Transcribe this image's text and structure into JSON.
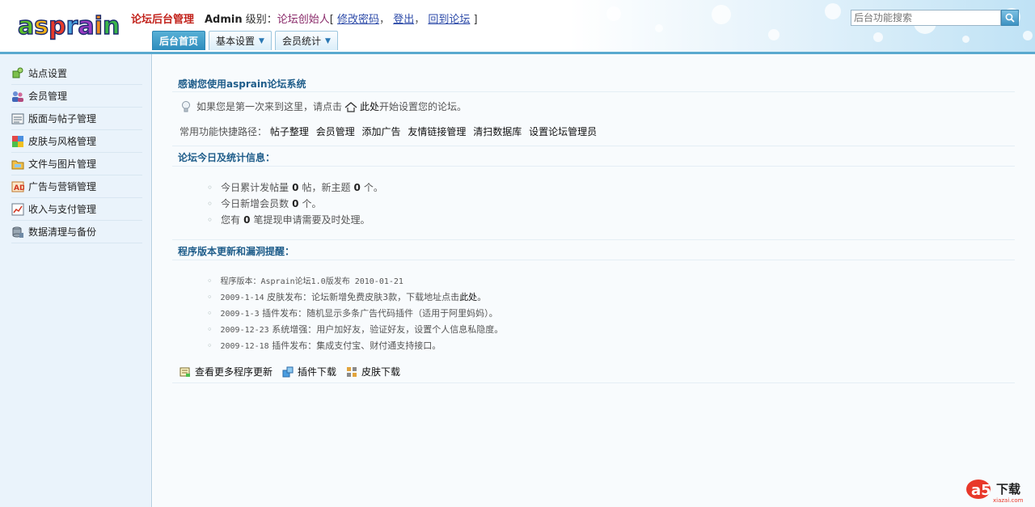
{
  "header": {
    "logo_text": "asprain",
    "app_title": "论坛后台管理",
    "user": {
      "name": "Admin",
      "level_label": "级别：",
      "role": "论坛创始人",
      "bracket_open": "[",
      "bracket_close": "]",
      "change_password": "修改密码",
      "logout": "登出",
      "back_to_forum": "回到论坛",
      "comma": "，"
    },
    "tabs": [
      {
        "label": "后台首页",
        "active": true
      },
      {
        "label": "基本设置",
        "dropdown": true
      },
      {
        "label": "会员统计",
        "dropdown": true
      }
    ],
    "search": {
      "placeholder": "后台功能搜索"
    }
  },
  "sidebar": {
    "items": [
      {
        "label": "站点设置",
        "icon": "puzzle-icon"
      },
      {
        "label": "会员管理",
        "icon": "users-icon"
      },
      {
        "label": "版面与帖子管理",
        "icon": "board-icon"
      },
      {
        "label": "皮肤与风格管理",
        "icon": "palette-icon"
      },
      {
        "label": "文件与图片管理",
        "icon": "folder-icon"
      },
      {
        "label": "广告与营销管理",
        "icon": "ad-icon"
      },
      {
        "label": "收入与支付管理",
        "icon": "chart-icon"
      },
      {
        "label": "数据清理与备份",
        "icon": "database-icon"
      }
    ]
  },
  "main": {
    "welcome": {
      "title": "感谢您使用asprain论坛系统",
      "tip_prefix": "如果您是第一次来到这里，请点击",
      "tip_link": "此处",
      "tip_suffix": "开始设置您的论坛。",
      "shortcuts_label": "常用功能快捷路径：",
      "shortcuts": [
        "帖子整理",
        "会员管理",
        "添加广告",
        "友情链接管理",
        "清扫数据库",
        "设置论坛管理员"
      ]
    },
    "stats": {
      "title": "论坛今日及统计信息：",
      "line1_a": "今日累计发帖量",
      "posts": "0",
      "line1_b": "帖，新主题",
      "topics": "0",
      "line1_c": "个。",
      "line2_a": "今日新增会员数",
      "members": "0",
      "line2_b": "个。",
      "line3_a": "您有",
      "withdrawals": "0",
      "line3_b": "笔提现申请需要及时处理。"
    },
    "updates": {
      "title": "程序版本更新和漏洞提醒：",
      "items": [
        {
          "date": "程序版本：Asprain论坛1.0版发布 2010-01-21"
        },
        {
          "date": "2009-1-14",
          "text": " 皮肤发布：论坛新增免费皮肤3款，下载地址点击",
          "link": "此处",
          "tail": "。"
        },
        {
          "date": "2009-1-3",
          "text": "  插件发布：随机显示多条广告代码插件（适用于阿里妈妈）。"
        },
        {
          "date": "2009-12-23",
          "text": " 系统增强：用户加好友，验证好友，设置个人信息私隐度。"
        },
        {
          "date": "2009-12-18",
          "text": " 插件发布：集成支付宝、财付通支持接口。"
        }
      ],
      "links": [
        {
          "label": "查看更多程序更新",
          "icon": "news-icon"
        },
        {
          "label": "插件下载",
          "icon": "plugin-icon"
        },
        {
          "label": "皮肤下载",
          "icon": "grid-icon"
        }
      ]
    }
  },
  "watermark": {
    "text": "下载",
    "sub": "xiazai.com"
  },
  "colors": {
    "accent": "#2e8dbd",
    "title_red": "#c2231c",
    "section_title": "#1f5d8a",
    "sidebar_bg": "#eaf3fb"
  }
}
